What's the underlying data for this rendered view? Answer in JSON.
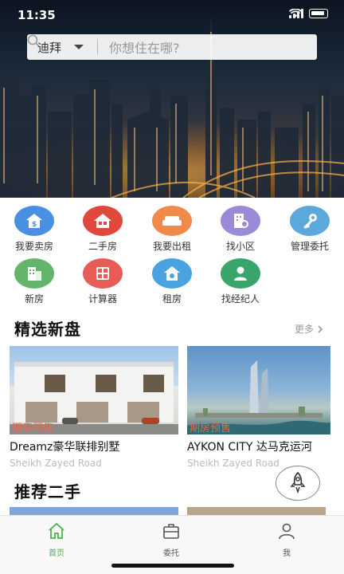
{
  "status": {
    "time": "11:35"
  },
  "search": {
    "city": "迪拜",
    "placeholder": "你想住在哪?"
  },
  "quick_menu": [
    {
      "label": "我要卖房",
      "icon": "house-dollar-icon",
      "color": "#4a90e2"
    },
    {
      "label": "二手房",
      "icon": "house-group-icon",
      "color": "#e0483c"
    },
    {
      "label": "我要出租",
      "icon": "sofa-icon",
      "color": "#f08a4b"
    },
    {
      "label": "找小区",
      "icon": "building-search-icon",
      "color": "#9a8ad8"
    },
    {
      "label": "管理委托",
      "icon": "key-icon",
      "color": "#5aa8dc"
    },
    {
      "label": "新房",
      "icon": "new-building-icon",
      "color": "#62b56a"
    },
    {
      "label": "计算器",
      "icon": "calculator-icon",
      "color": "#e85c58"
    },
    {
      "label": "租房",
      "icon": "rent-house-icon",
      "color": "#4aa3e0"
    },
    {
      "label": "找经纪人",
      "icon": "agent-icon",
      "color": "#3aa56a"
    }
  ],
  "featured": {
    "title": "精选新盘",
    "more": "更多",
    "cards": [
      {
        "tag": "期房预售",
        "name": "Dreamz豪华联排别墅",
        "road": "Sheikh Zayed Road"
      },
      {
        "tag": "期房预售",
        "name": "AYKON CITY 达马克运河",
        "road": "Sheikh Zayed Road"
      }
    ]
  },
  "recommend": {
    "title": "推荐二手"
  },
  "tabs": [
    {
      "label": "首页",
      "icon": "home-icon",
      "active": true
    },
    {
      "label": "委托",
      "icon": "briefcase-icon",
      "active": false
    },
    {
      "label": "我",
      "icon": "user-icon",
      "active": false
    }
  ],
  "colors": {
    "accent": "#4caf50",
    "tab_inactive": "#555555",
    "tag": "#e36b52"
  }
}
